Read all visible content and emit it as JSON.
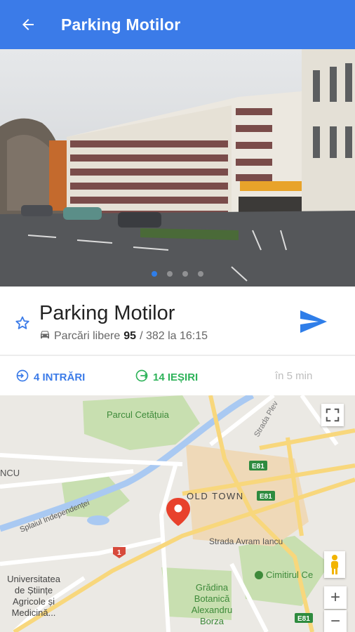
{
  "header": {
    "title": "Parking Motilor"
  },
  "carousel": {
    "count": 4,
    "active_index": 0
  },
  "parking": {
    "name": "Parking Motilor",
    "free_label": "Parcări libere",
    "free": "95",
    "total_text": "/ 382 la 16:15"
  },
  "entries": {
    "label": "4 INTRĂRI"
  },
  "exits": {
    "label": "14 IEȘIRI"
  },
  "eta": {
    "label": "în 5 min"
  },
  "map": {
    "labels": {
      "park": "Parcul Cetățuia",
      "street_plev": "Strada Plev",
      "left_cut": "NCU",
      "spl": "Splaiul Independenței",
      "old_town": "OLD TOWN",
      "e81_a": "E81",
      "e81_b": "E81",
      "e81_c": "E81",
      "route1": "1",
      "avram": "Strada Avram Iancu",
      "cimitir": "Cimitirul Ce",
      "univ1": "Universitatea",
      "univ2": "de Științe",
      "univ3": "Agricole și",
      "univ4": "Medicină...",
      "garden1": "Grădina",
      "garden2": "Botanică",
      "garden3": "Alexandru",
      "garden4": "Borza"
    },
    "zoom_in": "+",
    "zoom_out": "−"
  },
  "colors": {
    "primary": "#3b7be8",
    "exit": "#2fb35a",
    "pin": "#e8412c"
  }
}
